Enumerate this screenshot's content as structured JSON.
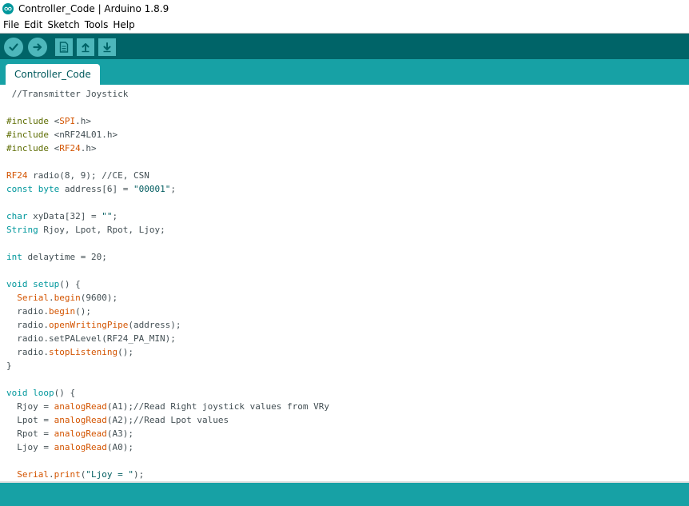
{
  "window": {
    "title": "Controller_Code | Arduino 1.8.9"
  },
  "menu": [
    "File",
    "Edit",
    "Sketch",
    "Tools",
    "Help"
  ],
  "toolbar": {
    "verify": "checkmark-icon",
    "upload": "arrow-right-icon",
    "new": "new-sketch-icon",
    "open": "open-arrow-up-icon",
    "save": "save-arrow-down-icon"
  },
  "tabs": [
    {
      "label": "Controller_Code"
    }
  ],
  "colors": {
    "toolbar_bg": "#006468",
    "tab_strip_bg": "#17a1a5",
    "button_bg": "#4db7bb",
    "keyword": "#00979c",
    "library_function": "#d35400",
    "preprocessor": "#5e6d03",
    "plain_text": "#434f54"
  },
  "code": [
    [
      {
        "t": " //Transmitter Joystick",
        "c": "comment"
      }
    ],
    [],
    [
      {
        "t": "#include",
        "c": "pre"
      },
      {
        "t": " <",
        "c": "plain"
      },
      {
        "t": "SPI",
        "c": "lib"
      },
      {
        "t": ".h>",
        "c": "plain"
      }
    ],
    [
      {
        "t": "#include",
        "c": "pre"
      },
      {
        "t": " <nRF24L01.h>",
        "c": "plain"
      }
    ],
    [
      {
        "t": "#include",
        "c": "pre"
      },
      {
        "t": " <",
        "c": "plain"
      },
      {
        "t": "RF24",
        "c": "lib"
      },
      {
        "t": ".h>",
        "c": "plain"
      }
    ],
    [],
    [
      {
        "t": "RF24",
        "c": "type"
      },
      {
        "t": " radio(8, 9); //CE, CSN",
        "c": "plain"
      }
    ],
    [
      {
        "t": "const",
        "c": "kw"
      },
      {
        "t": " ",
        "c": "plain"
      },
      {
        "t": "byte",
        "c": "kw"
      },
      {
        "t": " address[6] = ",
        "c": "plain"
      },
      {
        "t": "\"00001\"",
        "c": "str"
      },
      {
        "t": ";",
        "c": "plain"
      }
    ],
    [],
    [
      {
        "t": "char",
        "c": "kw"
      },
      {
        "t": " xyData[32] = ",
        "c": "plain"
      },
      {
        "t": "\"\"",
        "c": "str"
      },
      {
        "t": ";",
        "c": "plain"
      }
    ],
    [
      {
        "t": "String",
        "c": "kw"
      },
      {
        "t": " Rjoy, Lpot, Rpot, Ljoy;",
        "c": "plain"
      }
    ],
    [],
    [
      {
        "t": "int",
        "c": "kw"
      },
      {
        "t": " delaytime = 20;",
        "c": "plain"
      }
    ],
    [],
    [
      {
        "t": "void",
        "c": "kw"
      },
      {
        "t": " ",
        "c": "plain"
      },
      {
        "t": "setup",
        "c": "kw"
      },
      {
        "t": "() {",
        "c": "plain"
      }
    ],
    [
      {
        "t": "  ",
        "c": "plain"
      },
      {
        "t": "Serial",
        "c": "type"
      },
      {
        "t": ".",
        "c": "plain"
      },
      {
        "t": "begin",
        "c": "fn"
      },
      {
        "t": "(9600);",
        "c": "plain"
      }
    ],
    [
      {
        "t": "  radio.",
        "c": "plain"
      },
      {
        "t": "begin",
        "c": "fn"
      },
      {
        "t": "();",
        "c": "plain"
      }
    ],
    [
      {
        "t": "  radio.",
        "c": "plain"
      },
      {
        "t": "openWritingPipe",
        "c": "fn"
      },
      {
        "t": "(address);",
        "c": "plain"
      }
    ],
    [
      {
        "t": "  radio.setPALevel(RF24_PA_MIN);",
        "c": "plain"
      }
    ],
    [
      {
        "t": "  radio.",
        "c": "plain"
      },
      {
        "t": "stopListening",
        "c": "fn"
      },
      {
        "t": "();",
        "c": "plain"
      }
    ],
    [
      {
        "t": "}",
        "c": "plain"
      }
    ],
    [],
    [
      {
        "t": "void",
        "c": "kw"
      },
      {
        "t": " ",
        "c": "plain"
      },
      {
        "t": "loop",
        "c": "kw"
      },
      {
        "t": "() {",
        "c": "plain"
      }
    ],
    [
      {
        "t": "  Rjoy = ",
        "c": "plain"
      },
      {
        "t": "analogRead",
        "c": "fn"
      },
      {
        "t": "(A1);//Read Right joystick values from VRy",
        "c": "plain"
      }
    ],
    [
      {
        "t": "  Lpot = ",
        "c": "plain"
      },
      {
        "t": "analogRead",
        "c": "fn"
      },
      {
        "t": "(A2);//Read Lpot values",
        "c": "plain"
      }
    ],
    [
      {
        "t": "  Rpot = ",
        "c": "plain"
      },
      {
        "t": "analogRead",
        "c": "fn"
      },
      {
        "t": "(A3);",
        "c": "plain"
      }
    ],
    [
      {
        "t": "  Ljoy = ",
        "c": "plain"
      },
      {
        "t": "analogRead",
        "c": "fn"
      },
      {
        "t": "(A0);",
        "c": "plain"
      }
    ],
    [],
    [
      {
        "t": "  ",
        "c": "plain"
      },
      {
        "t": "Serial",
        "c": "type"
      },
      {
        "t": ".",
        "c": "plain"
      },
      {
        "t": "print",
        "c": "fn"
      },
      {
        "t": "(",
        "c": "plain"
      },
      {
        "t": "\"Ljoy = \"",
        "c": "str"
      },
      {
        "t": ");",
        "c": "plain"
      }
    ]
  ]
}
